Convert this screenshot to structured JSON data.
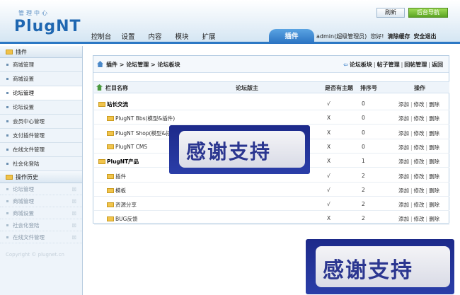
{
  "header": {
    "logo_sub": "管理中心",
    "logo": "PlugNT",
    "refresh_label": "刷新",
    "home_label": "后台导航",
    "nav": [
      "控制台",
      "设置",
      "内容",
      "模块",
      "扩展",
      "插件"
    ],
    "active_nav": "插件",
    "user": "admin(超级管理员)",
    "greeting": "您好!",
    "clear_cache": "清除缓存",
    "logout": "安全退出"
  },
  "sidebar": {
    "section_title": "插件",
    "items": [
      "商城管理",
      "商城设置",
      "论坛管理",
      "论坛设置",
      "会员中心管理",
      "支付插件管理",
      "在线文件管理",
      "社会化登陆"
    ],
    "active_item": "论坛管理",
    "history_title": "操作历史",
    "history": [
      "论坛管理",
      "商城管理",
      "商城设置",
      "社会化登陆",
      "在线文件管理"
    ],
    "copyright": "Copyright © plugnet.cn"
  },
  "panel": {
    "breadcrumb": "插件 > 论坛管理 > 论坛板块",
    "links": [
      "论坛板块",
      "帖子管理",
      "回帖管理",
      "返回"
    ],
    "columns": [
      "栏目名称",
      "论坛版主",
      "是否有主题",
      "排序号",
      "操作"
    ],
    "rows": [
      {
        "name": "站长交流",
        "has_topic": "√",
        "order": "0",
        "level": 0,
        "bold": true
      },
      {
        "name": "PlugNT Bbs(模型&插件)",
        "has_topic": "X",
        "order": "0",
        "level": 1,
        "bold": false
      },
      {
        "name": "PlugNT Shop(模型&插件)",
        "has_topic": "X",
        "order": "0",
        "level": 1,
        "bold": false
      },
      {
        "name": "PlugNT CMS",
        "has_topic": "X",
        "order": "0",
        "level": 1,
        "bold": false
      },
      {
        "name": "PlugNT产品",
        "has_topic": "X",
        "order": "1",
        "level": 0,
        "bold": true
      },
      {
        "name": "插件",
        "has_topic": "√",
        "order": "2",
        "level": 1,
        "bold": false
      },
      {
        "name": "模板",
        "has_topic": "√",
        "order": "2",
        "level": 1,
        "bold": false
      },
      {
        "name": "资源分享",
        "has_topic": "√",
        "order": "2",
        "level": 1,
        "bold": false
      },
      {
        "name": "BUG反馈",
        "has_topic": "X",
        "order": "2",
        "level": 1,
        "bold": false
      }
    ],
    "op_labels": [
      "添加",
      "修改",
      "删除"
    ]
  },
  "watermark": {
    "text": "感谢支持"
  }
}
